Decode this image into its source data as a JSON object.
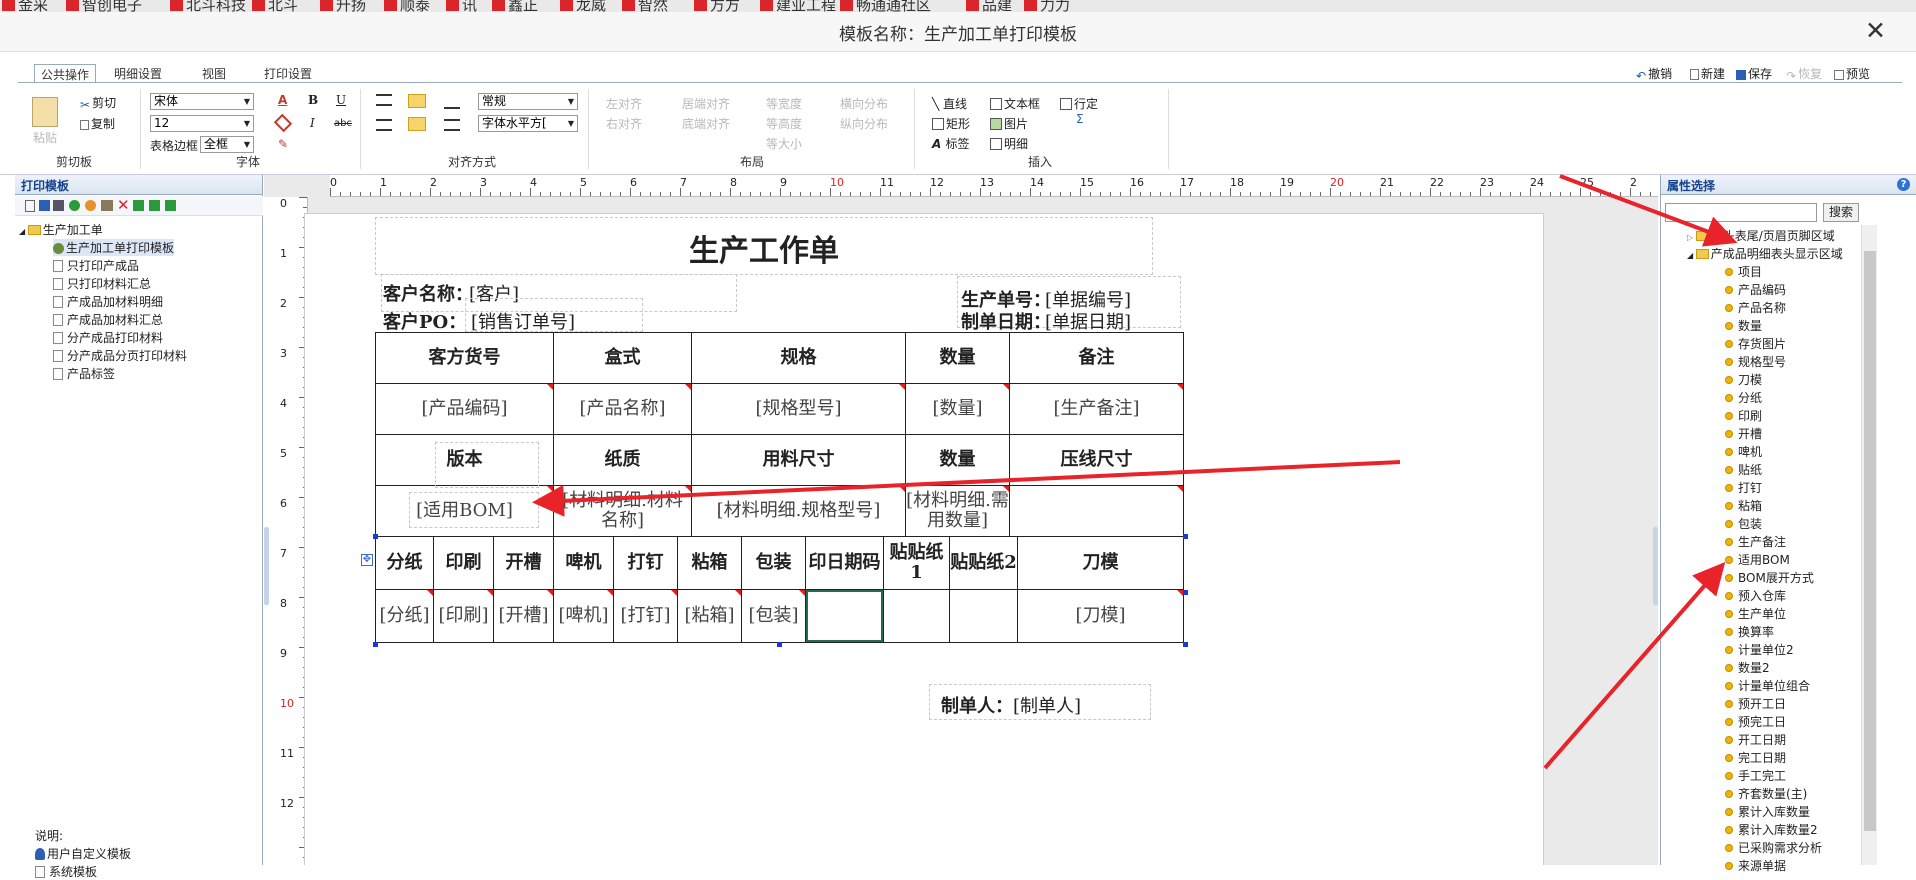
{
  "bookmarks": [
    "金采",
    "智创电子",
    "北斗科技",
    "北斗",
    "升扬",
    "顺泰",
    "讯",
    "鑫正",
    "龙威",
    "智然",
    "方方",
    "建业工程",
    "畅通通社区",
    "品建",
    "力力"
  ],
  "window": {
    "title": "模板名称：生产加工单打印模板",
    "close": "✕"
  },
  "ribbon": {
    "tabs": [
      "公共操作",
      "明细设置",
      "视图",
      "打印设置"
    ],
    "actions": {
      "undo": "撤销",
      "new": "新建",
      "save": "保存",
      "restore": "恢复",
      "preview": "预览"
    },
    "clipboard": {
      "paste": "粘贴",
      "cut": "剪切",
      "copy": "复制",
      "label": "剪切板"
    },
    "font": {
      "family": "宋体",
      "size": "12",
      "border_label": "表格边框",
      "border_value": "全框",
      "label": "字体",
      "a": "A",
      "b": "B",
      "i": "I",
      "u": "U",
      "s": "abc"
    },
    "align": {
      "style": "常规",
      "halign": "字体水平方[",
      "label": "对齐方式"
    },
    "layout": {
      "items": [
        "左对齐",
        "居端对齐",
        "等宽度",
        "横向分布",
        "右对齐",
        "底端对齐",
        "等高度",
        "纵向分布",
        "等大小"
      ],
      "label": "布局"
    },
    "insert": {
      "line": "直线",
      "textbox": "文本框",
      "row": "行定",
      "rect": "矩形",
      "image": "图片",
      "detail": "明细",
      "label_item": "标签",
      "sigma": "Σ",
      "label": "插入"
    }
  },
  "left": {
    "title": "打印模板",
    "root": "生产加工单",
    "items": [
      "生产加工单打印模板",
      "只打印产成品",
      "只打印材料汇总",
      "产成品加材料明细",
      "产成品加材料汇总",
      "分产成品打印材料",
      "分产成品分页打印材料",
      "产品标签"
    ],
    "note_title": "说明:",
    "note_items": [
      "用户自定义模板",
      "系统模板"
    ]
  },
  "ruler": {
    "h": [
      "0",
      "1",
      "2",
      "3",
      "4",
      "5",
      "6",
      "7",
      "8",
      "9",
      "10",
      "11",
      "12",
      "13",
      "14",
      "15",
      "16",
      "17",
      "18",
      "19",
      "20",
      "21",
      "22",
      "23",
      "24",
      "25",
      "2"
    ],
    "v": [
      "0",
      "1",
      "2",
      "3",
      "4",
      "5",
      "6",
      "7",
      "8",
      "9",
      "10",
      "11",
      "12"
    ]
  },
  "doc": {
    "title": "生产工作单",
    "customer_label": "客户名称：",
    "customer_value": "[客户]",
    "po_label": "客户PO：",
    "po_value": "[销售订单号]",
    "order_label": "生产单号：",
    "order_value": "[单据编号]",
    "date_label": "制单日期：",
    "date_value": "[单据日期]",
    "t1_headers": [
      "客方货号",
      "盒式",
      "规格",
      "数量",
      "备注"
    ],
    "t1_values": [
      "[产品编码]",
      "[产品名称]",
      "[规格型号]",
      "[数量]",
      "[生产备注]"
    ],
    "t2_headers": [
      "版本",
      "纸质",
      "用料尺寸",
      "数量",
      "压线尺寸"
    ],
    "t2_values": [
      "[适用BOM]",
      "[材料明细.材料名称]",
      "[材料明细.规格型号]",
      "[材料明细.需用数量]",
      ""
    ],
    "t3_headers": [
      "分纸",
      "印刷",
      "开槽",
      "啤机",
      "打钉",
      "粘箱",
      "包装",
      "印日期码",
      "贴贴纸1",
      "贴贴纸2",
      "刀模"
    ],
    "t3_values": [
      "[分纸]",
      "[印刷]",
      "[开槽]",
      "[啤机]",
      "[打钉]",
      "[粘箱]",
      "[包装]",
      "",
      "",
      "",
      "[刀模]"
    ],
    "maker_label": "制单人：",
    "maker_value": "[制单人]"
  },
  "right": {
    "title": "属性选择",
    "search_placeholder": "",
    "search_button": "搜索",
    "node1": "表头表尾/页眉页脚区域",
    "node2": "产成品明细表头显示区域",
    "props": [
      "项目",
      "产品编码",
      "产品名称",
      "数量",
      "存货图片",
      "规格型号",
      "刀模",
      "分纸",
      "印刷",
      "开槽",
      "啤机",
      "贴纸",
      "打钉",
      "粘箱",
      "包装",
      "生产备注",
      "适用BOM",
      "BOM展开方式",
      "预入仓库",
      "生产单位",
      "换算率",
      "计量单位2",
      "数量2",
      "计量单位组合",
      "预开工日",
      "预完工日",
      "开工日期",
      "完工日期",
      "手工完工",
      "齐套数量(主)",
      "累计入库数量",
      "累计入库数量2",
      "已采购需求分析",
      "来源单据"
    ]
  },
  "colors": {
    "arrow": "#e8232a",
    "accent": "#15428b"
  }
}
